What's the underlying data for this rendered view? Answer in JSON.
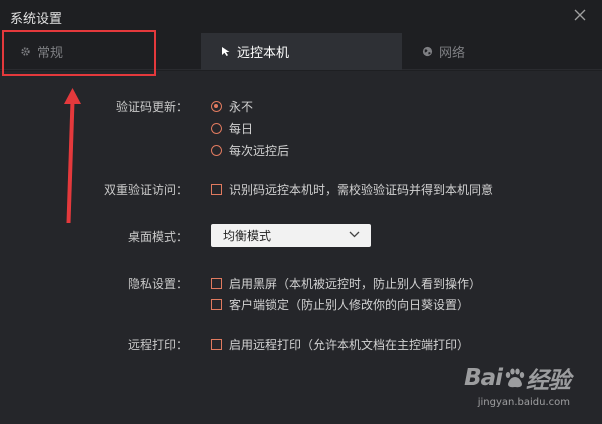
{
  "window": {
    "title": "系统设置"
  },
  "tabs": [
    {
      "label": "常规",
      "icon": "gear-icon"
    },
    {
      "label": "远控本机",
      "icon": "cursor-icon"
    },
    {
      "label": "网络",
      "icon": "globe-icon"
    }
  ],
  "settings": {
    "code_update": {
      "label": "验证码更新：",
      "options": [
        "永不",
        "每日",
        "每次远控后"
      ],
      "selected": "永不"
    },
    "double_verify": {
      "label": "双重验证访问：",
      "checkbox": "识别码远控本机时，需校验验证码并得到本机同意"
    },
    "desktop_mode": {
      "label": "桌面模式：",
      "value": "均衡模式"
    },
    "privacy": {
      "label": "隐私设置：",
      "checkboxes": [
        "启用黑屏（本机被远控时，防止别人看到操作）",
        "客户端锁定（防止别人修改你的向日葵设置）"
      ]
    },
    "remote_print": {
      "label": "远程打印：",
      "checkbox": "启用远程打印（允许本机文档在主控端打印）"
    }
  },
  "watermark": {
    "brand": "Bai",
    "brand2": "经验",
    "url": "jingyan.baidu.com"
  },
  "colors": {
    "accent": "#e07a5f",
    "annotation": "#e4393c"
  }
}
